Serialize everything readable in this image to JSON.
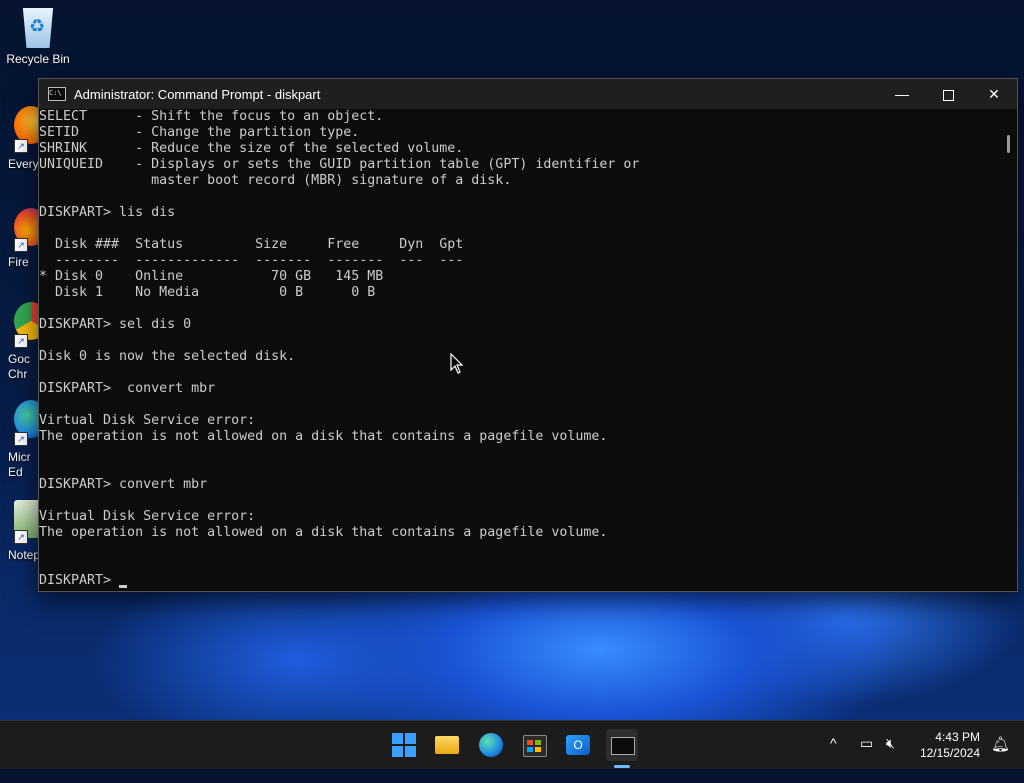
{
  "desktop": {
    "icons": [
      {
        "label": "Recycle Bin"
      },
      {
        "label": "Every"
      },
      {
        "label": "Fire"
      },
      {
        "label": "Goc\nChr"
      },
      {
        "label": "Micr\nEd"
      },
      {
        "label": "Notep"
      }
    ]
  },
  "window": {
    "title": "Administrator: Command Prompt - diskpart",
    "minimize_glyph": "—",
    "close_glyph": "✕",
    "lines": [
      "SELECT      - Shift the focus to an object.",
      "SETID       - Change the partition type.",
      "SHRINK      - Reduce the size of the selected volume.",
      "UNIQUEID    - Displays or sets the GUID partition table (GPT) identifier or",
      "              master boot record (MBR) signature of a disk.",
      "",
      "DISKPART> lis dis",
      "",
      "  Disk ###  Status         Size     Free     Dyn  Gpt",
      "  --------  -------------  -------  -------  ---  ---",
      "* Disk 0    Online           70 GB   145 MB",
      "  Disk 1    No Media          0 B      0 B",
      "",
      "DISKPART> sel dis 0",
      "",
      "Disk 0 is now the selected disk.",
      "",
      "DISKPART>  convert mbr",
      "",
      "Virtual Disk Service error:",
      "The operation is not allowed on a disk that contains a pagefile volume.",
      "",
      "",
      "DISKPART> convert mbr",
      "",
      "Virtual Disk Service error:",
      "The operation is not allowed on a disk that contains a pagefile volume.",
      "",
      ""
    ],
    "prompt": "DISKPART> "
  },
  "taskbar": {
    "tray_chevron": "^",
    "clock_time": "4:43 PM",
    "clock_date": "12/15/2024"
  },
  "colors": {
    "console_bg": "#0c0c0c",
    "console_fg": "#cccccc",
    "accent": "#3aa0ff"
  }
}
